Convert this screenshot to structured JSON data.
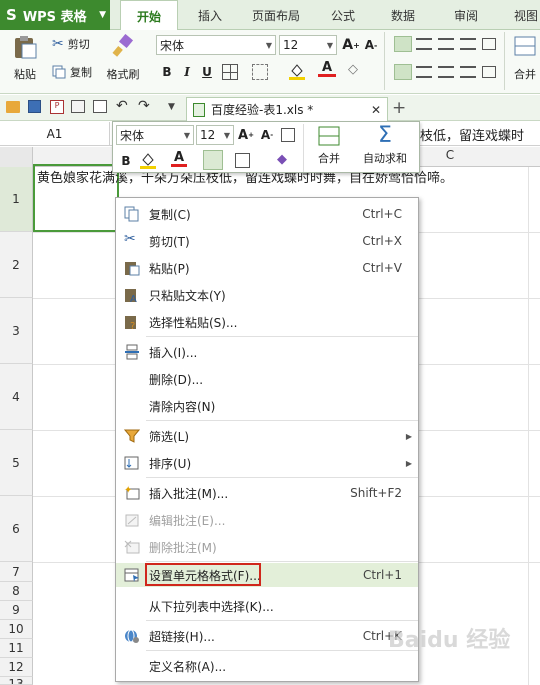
{
  "app": {
    "logo": "WPS 表格",
    "logo_icon": "S"
  },
  "menu_tabs": [
    "开始",
    "插入",
    "页面布局",
    "公式",
    "数据",
    "审阅",
    "视图"
  ],
  "ribbon": {
    "paste": "粘贴",
    "cut": "剪切",
    "copy": "复制",
    "format_painter": "格式刷",
    "font_name": "宋体",
    "font_size": "12",
    "bold": "B",
    "italic": "I",
    "underline": "U",
    "merge": "合并"
  },
  "document_tab": "百度经验-表1.xls *",
  "formula_bar": {
    "cell_ref": "A1",
    "content": "枝低，留连戏蝶时"
  },
  "columns": {
    "c": "C"
  },
  "rows": [
    "1",
    "2",
    "3",
    "4",
    "5",
    "6",
    "7",
    "8",
    "9",
    "10",
    "11",
    "12",
    "13"
  ],
  "cell_a1": "黄色娘家花满溪，千朵万朵压枝低，留连戏蝶时时舞，自在娇莺恰恰啼。",
  "mini_toolbar": {
    "font_name": "宋体",
    "font_size": "12",
    "bold": "B",
    "merge": "合并",
    "autosum": "自动求和"
  },
  "context_menu": [
    {
      "label": "复制(C)",
      "shortcut": "Ctrl+C",
      "icon": "copy-icon"
    },
    {
      "label": "剪切(T)",
      "shortcut": "Ctrl+X",
      "icon": "cut-icon"
    },
    {
      "label": "粘贴(P)",
      "shortcut": "Ctrl+V",
      "icon": "paste-icon"
    },
    {
      "label": "只粘贴文本(Y)",
      "shortcut": "",
      "icon": "paste-text-icon"
    },
    {
      "label": "选择性粘贴(S)...",
      "shortcut": "",
      "icon": "paste-special-icon"
    },
    {
      "label": "插入(I)...",
      "shortcut": "",
      "icon": "insert-icon"
    },
    {
      "label": "删除(D)...",
      "shortcut": "",
      "icon": ""
    },
    {
      "label": "清除内容(N)",
      "shortcut": "",
      "icon": ""
    },
    {
      "label": "筛选(L)",
      "shortcut": "",
      "icon": "filter-icon"
    },
    {
      "label": "排序(U)",
      "shortcut": "",
      "icon": "sort-icon"
    },
    {
      "label": "插入批注(M)...",
      "shortcut": "Shift+F2",
      "icon": "insert-comment-icon"
    },
    {
      "label": "编辑批注(E)...",
      "shortcut": "",
      "icon": "edit-comment-icon"
    },
    {
      "label": "删除批注(M)",
      "shortcut": "",
      "icon": "delete-comment-icon"
    },
    {
      "label": "设置单元格格式(F)...",
      "shortcut": "Ctrl+1",
      "icon": "format-cells-icon"
    },
    {
      "label": "从下拉列表中选择(K)...",
      "shortcut": "",
      "icon": ""
    },
    {
      "label": "超链接(H)...",
      "shortcut": "Ctrl+K",
      "icon": "hyperlink-icon"
    },
    {
      "label": "定义名称(A)...",
      "shortcut": "",
      "icon": ""
    }
  ],
  "watermark": "Baidu 经验",
  "colors": {
    "brand": "#3d8a2e",
    "highlight": "#d0271c"
  }
}
